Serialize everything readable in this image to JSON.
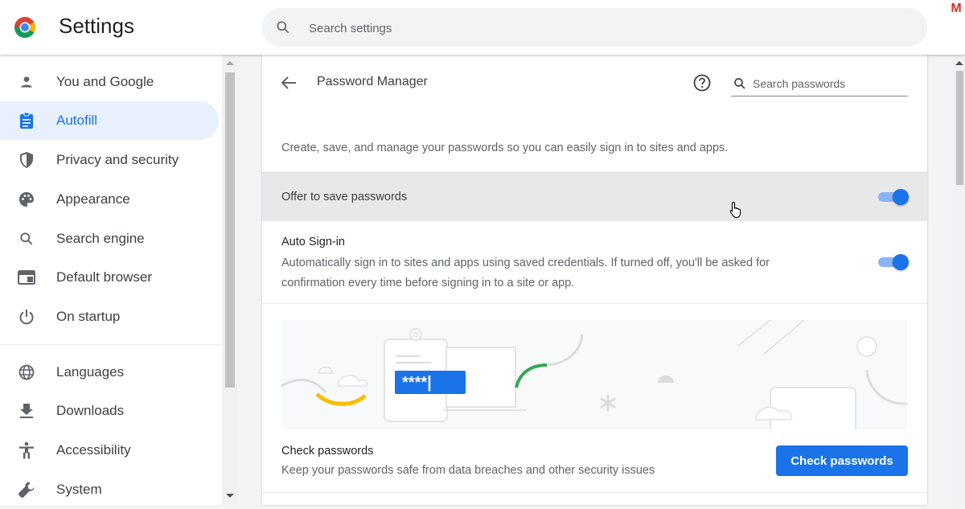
{
  "app": {
    "title": "Settings"
  },
  "search": {
    "placeholder": "Search settings"
  },
  "corner_badge": "M",
  "sidebar": {
    "items": [
      {
        "label": "You and Google",
        "icon": "person-icon",
        "active": false
      },
      {
        "label": "Autofill",
        "icon": "clipboard-icon",
        "active": true
      },
      {
        "label": "Privacy and security",
        "icon": "shield-icon",
        "active": false
      },
      {
        "label": "Appearance",
        "icon": "palette-icon",
        "active": false
      },
      {
        "label": "Search engine",
        "icon": "search-icon",
        "active": false
      },
      {
        "label": "Default browser",
        "icon": "browser-icon",
        "active": false
      },
      {
        "label": "On startup",
        "icon": "power-icon",
        "active": false
      },
      {
        "label": "Languages",
        "icon": "globe-icon",
        "active": false
      },
      {
        "label": "Downloads",
        "icon": "download-icon",
        "active": false
      },
      {
        "label": "Accessibility",
        "icon": "accessibility-icon",
        "active": false
      },
      {
        "label": "System",
        "icon": "wrench-icon",
        "active": false
      }
    ]
  },
  "password_manager": {
    "title": "Password Manager",
    "search_placeholder": "Search passwords",
    "description": "Create, save, and manage your passwords so you can easily sign in to sites and apps.",
    "offer_to_save": {
      "label": "Offer to save passwords",
      "enabled": true
    },
    "auto_signin": {
      "title": "Auto Sign-in",
      "description": "Automatically sign in to sites and apps using saved credentials. If turned off, you'll be asked for confirmation every time before signing in to a site or app.",
      "enabled": true
    },
    "illustration": {
      "masked_text": "****|"
    },
    "check_passwords": {
      "title": "Check passwords",
      "description": "Keep your passwords safe from data breaches and other security issues",
      "button_label": "Check passwords"
    }
  },
  "colors": {
    "accent": "#1a73e8",
    "active_bg": "#e8f0fe",
    "toggle_track": "#8ab4f8"
  }
}
